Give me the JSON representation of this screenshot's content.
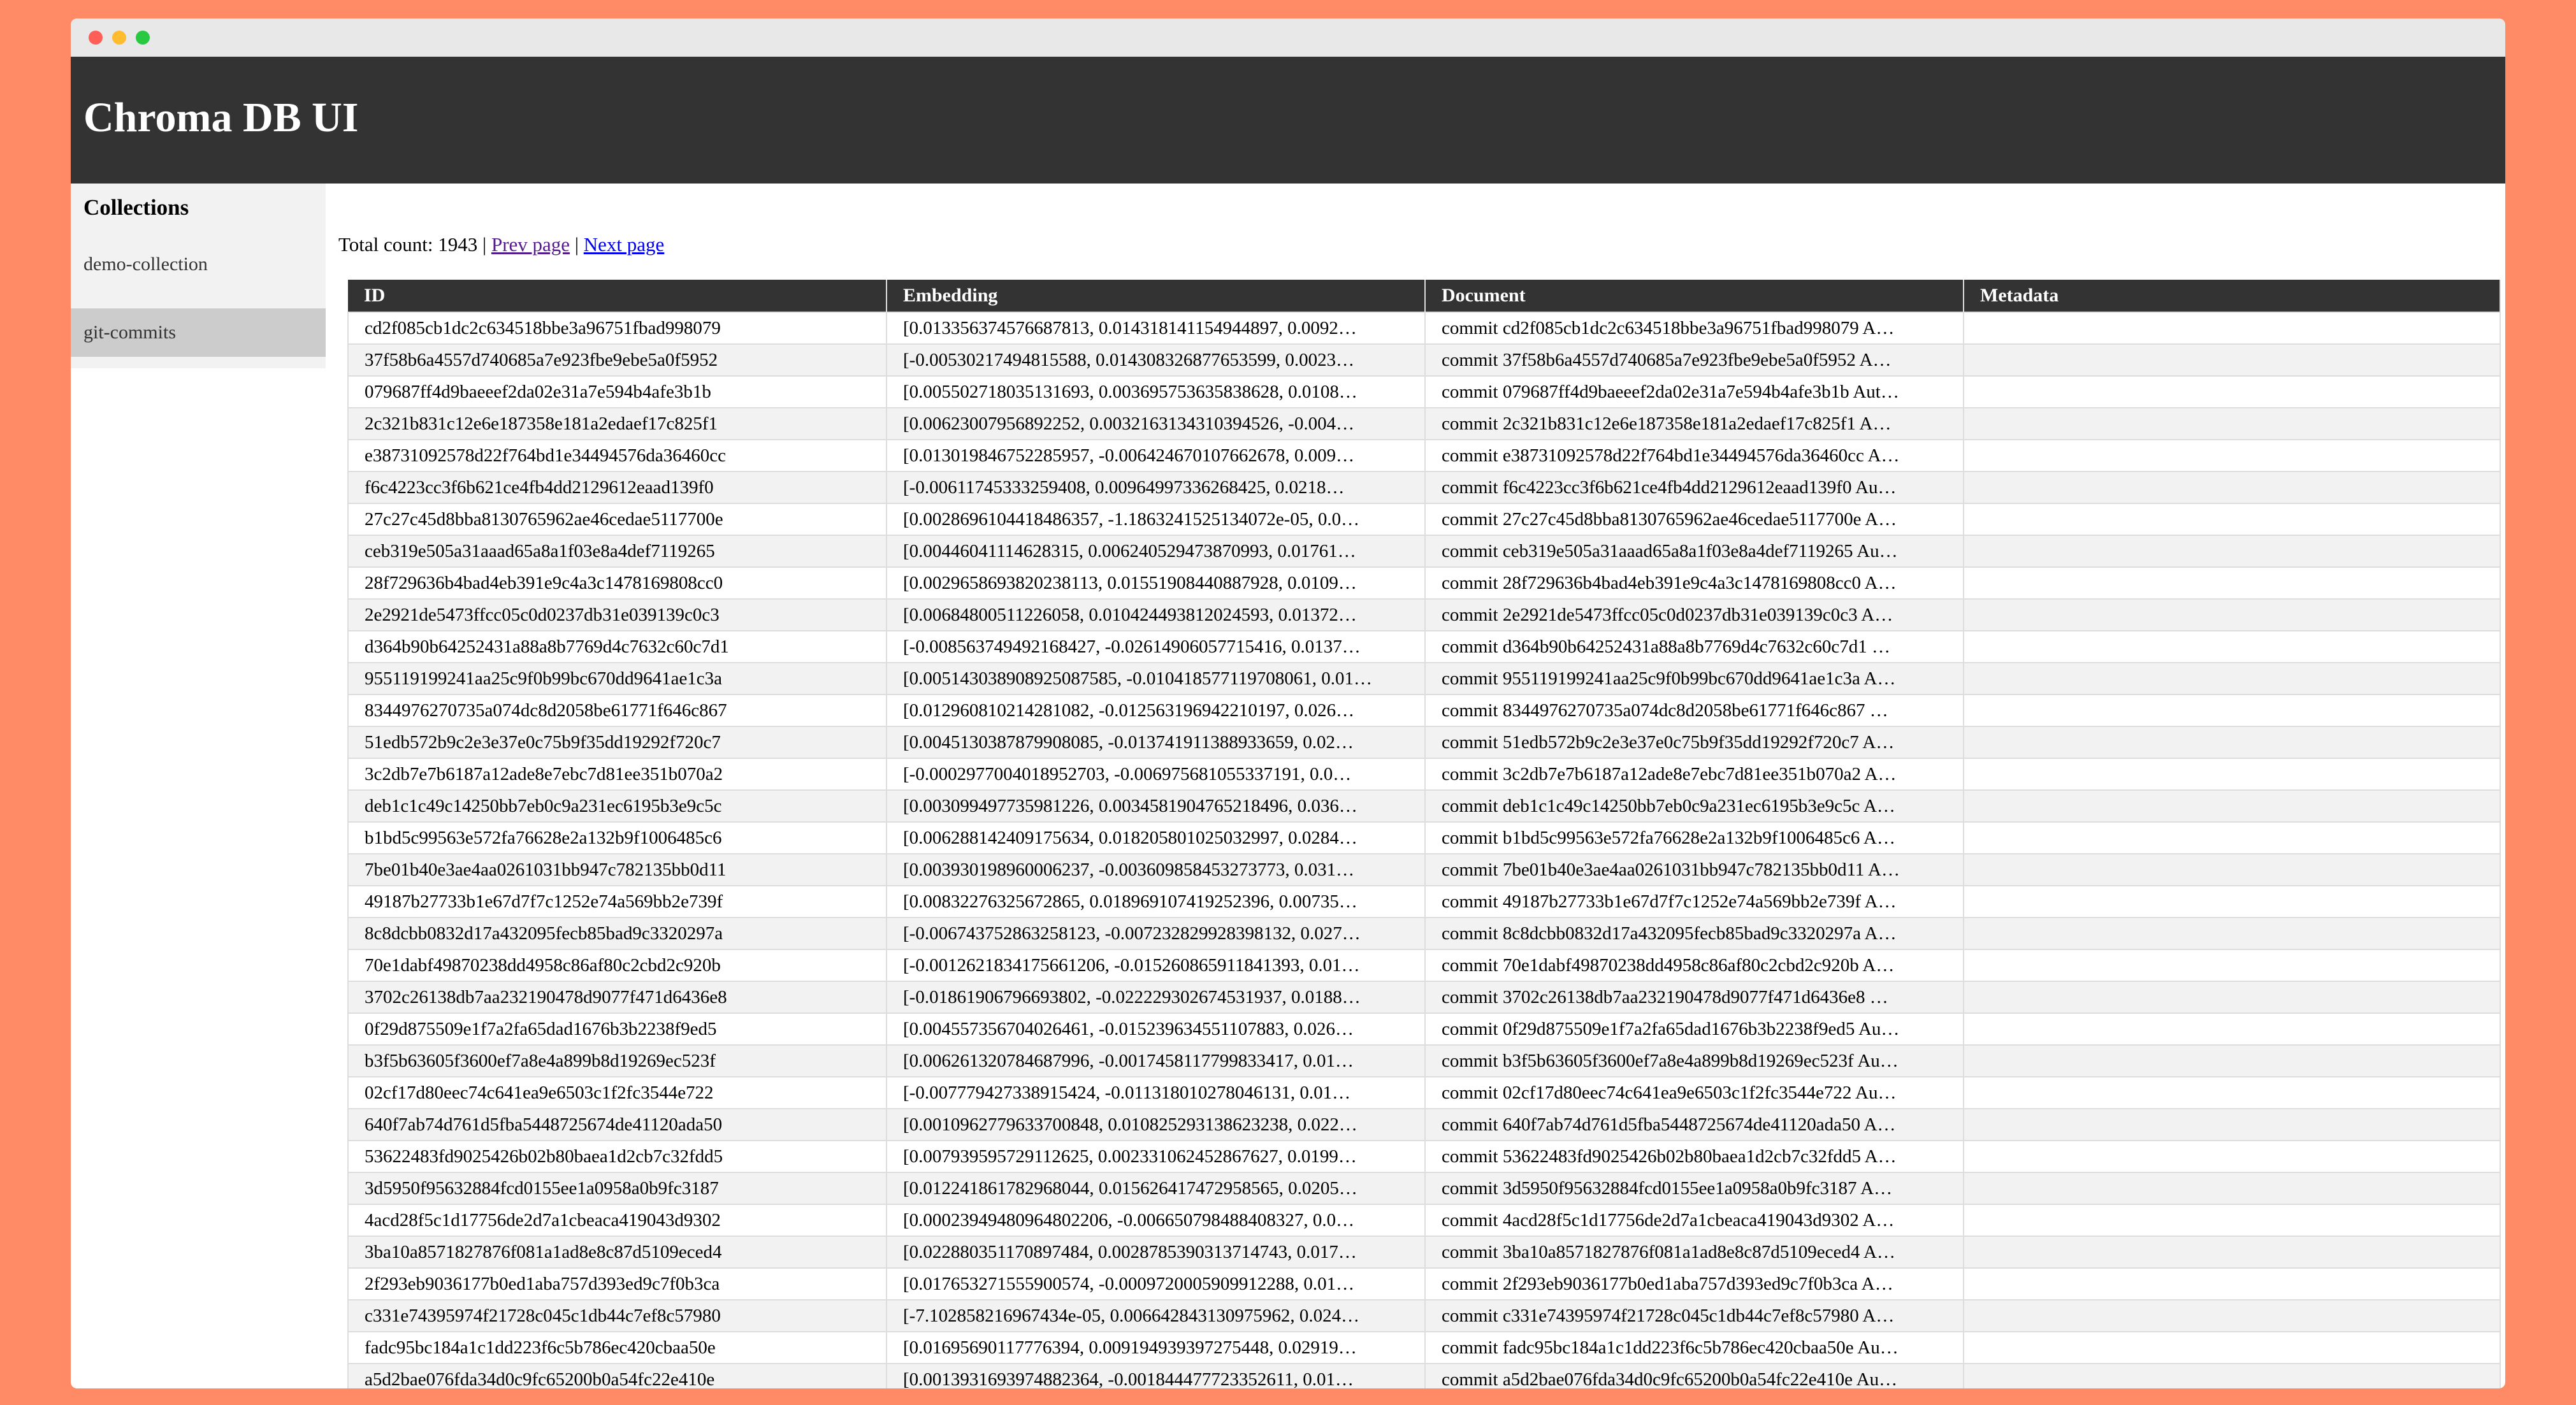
{
  "app": {
    "title": "Chroma DB UI"
  },
  "sidebar": {
    "heading": "Collections",
    "items": [
      {
        "label": "demo-collection"
      },
      {
        "label": "git-commits"
      }
    ]
  },
  "pager": {
    "total_label": "Total count: 1943",
    "separator": "|",
    "prev_label": "Prev page",
    "next_label": "Next page"
  },
  "table": {
    "columns": [
      "ID",
      "Embedding",
      "Document",
      "Metadata"
    ],
    "rows": [
      {
        "id": "cd2f085cb1dc2c634518bbe3a96751fbad998079",
        "embedding": "[0.013356374576687813, 0.014318141154944897, 0.0092…",
        "document": "commit cd2f085cb1dc2c634518bbe3a96751fbad998079 A…",
        "metadata": ""
      },
      {
        "id": "37f58b6a4557d740685a7e923fbe9ebe5a0f5952",
        "embedding": "[-0.00530217494815588, 0.014308326877653599, 0.0023…",
        "document": "commit 37f58b6a4557d740685a7e923fbe9ebe5a0f5952 A…",
        "metadata": ""
      },
      {
        "id": "079687ff4d9baeeef2da02e31a7e594b4afe3b1b",
        "embedding": "[0.005502718035131693, 0.003695753635838628, 0.0108…",
        "document": "commit 079687ff4d9baeeef2da02e31a7e594b4afe3b1b Aut…",
        "metadata": ""
      },
      {
        "id": "2c321b831c12e6e187358e181a2edaef17c825f1",
        "embedding": "[0.00623007956892252, 0.003216313431039452​6, -0.004…",
        "document": "commit 2c321b831c12e6e187358e181a2edaef17c825f1 A…",
        "metadata": ""
      },
      {
        "id": "e38731092578d22f764bd1e34494576da36460cc",
        "embedding": "[0.013019846752285957, -0.006424670107662678, 0.009…",
        "document": "commit e38731092578d22f764bd1e34494576da36460cc A…",
        "metadata": ""
      },
      {
        "id": "f6c4223cc3f6b621ce4fb4dd2129612eaad139f0",
        "embedding": "[-0.00611745333259408, 0.00964997336268425, 0.0218…",
        "document": "commit f6c4223cc3f6b621ce4fb4dd2129612eaad139f0 Au…",
        "metadata": ""
      },
      {
        "id": "27c27c45d8bba8130765962ae46cedae5117700e",
        "embedding": "[0.0028696104418486357, -1.1863241525134072e-05, 0.0…",
        "document": "commit 27c27c45d8bba8130765962ae46cedae5117700e A…",
        "metadata": ""
      },
      {
        "id": "ceb319e505a31aaad65a8a1f03e8a4def7119265",
        "embedding": "[0.00446041114628315, 0.006240529473870993, 0.01761…",
        "document": "commit ceb319e505a31aaad65a8a1f03e8a4def7119265 Au…",
        "metadata": ""
      },
      {
        "id": "28f729636b4bad4eb391e9c4a3c1478169808cc0",
        "embedding": "[0.0029658693820238113, 0.01551908440887928, 0.0109…",
        "document": "commit 28f729636b4bad4eb391e9c4a3c1478169808cc0 A…",
        "metadata": ""
      },
      {
        "id": "2e2921de5473ffcc05c0d0237db31e039139c0c3",
        "embedding": "[0.00684800511226058, 0.010424493812024593, 0.01372…",
        "document": "commit 2e2921de5473ffcc05c0d0237db31e039139c0c3 A…",
        "metadata": ""
      },
      {
        "id": "d364b90b64252431a88a8b7769d4c7632c60c7d1",
        "embedding": "[-0.008563749492168427, -0.02614906057715416, 0.0137…",
        "document": "commit d364b90b64252431a88a8b7769d4c7632c60c7d1 …",
        "metadata": ""
      },
      {
        "id": "955119199241aa25c9f0b99bc670dd9641ae1c3a",
        "embedding": "[0.005143038908925087585, -0.01041857711970806​1, 0.01…",
        "document": "commit 955119199241aa25c9f0b99bc670dd9641ae1c3a A…",
        "metadata": ""
      },
      {
        "id": "8344976270735a074dc8d2058be61771f646c867",
        "embedding": "[0.012960810214281082, -0.012563196942210197, 0.026…",
        "document": "commit 8344976270735a074dc8d2058be61771f646c867 …",
        "metadata": ""
      },
      {
        "id": "51edb572b9c2e3e37e0c75b9f35dd19292f720c7",
        "embedding": "[0.0045130387879908085, -0.013741911388933659, 0.02…",
        "document": "commit 51edb572b9c2e3e37e0c75b9f35dd19292f720c7 A…",
        "metadata": ""
      },
      {
        "id": "3c2db7e7b6187a12ade8e7ebc7d81ee351b070a2",
        "embedding": "[-0.0002977004018952703, -0.006975681055337191, 0.0…",
        "document": "commit 3c2db7e7b6187a12ade8e7ebc7d81ee351b070a2 A…",
        "metadata": ""
      },
      {
        "id": "deb1c1c49c14250bb7eb0c9a231ec6195b3e9c5c",
        "embedding": "[0.003099497735981226, 0.0034581904765218496, 0.036…",
        "document": "commit deb1c1c49c14250bb7eb0c9a231ec6195b3e9c5c A…",
        "metadata": ""
      },
      {
        "id": "b1bd5c99563e572fa76628e2a132b9f1006485c6",
        "embedding": "[0.006288142409175634, 0.018205801025032997, 0.0284…",
        "document": "commit b1bd5c99563e572fa76628e2a132b9f1006485c6 A…",
        "metadata": ""
      },
      {
        "id": "7be01b40e3ae4aa0261031bb947c782135bb0d11",
        "embedding": "[0.003930198960006237, -0.003609858453273773, 0.031…",
        "document": "commit 7be01b40e3ae4aa0261031bb947c782135bb0d11 A…",
        "metadata": ""
      },
      {
        "id": "49187b27733b1e67d7f7c1252e74a569bb2e739f",
        "embedding": "[0.008322763256728​65, 0.018969107419252396, 0.00735…",
        "document": "commit 49187b27733b1e67d7f7c1252e74a569bb2e739f A…",
        "metadata": ""
      },
      {
        "id": "8c8dcbb0832d17a432095fecb85bad9c3320297a",
        "embedding": "[-0.006743752863258123, -0.007232829928398132, 0.027…",
        "document": "commit 8c8dcbb0832d17a432095fecb85bad9c3320297a A…",
        "metadata": ""
      },
      {
        "id": "70e1dabf49870238dd4958c86af80c2cbd2c920b",
        "embedding": "[-0.001262183417566​1206, -0.015260865911841393, 0.01…",
        "document": "commit 70e1dabf49870238dd4958c86af80c2cbd2c920b A…",
        "metadata": ""
      },
      {
        "id": "3702c26138db7aa232190478d9077f471d6436e8",
        "embedding": "[-0.01861906796693802, -0.022229302674531937, 0.0188…",
        "document": "commit 3702c26138db7aa232190478d9077f471d6436e8 …",
        "metadata": ""
      },
      {
        "id": "0f29d875509e1f7a2fa65dad1676b3b2238f9ed5",
        "embedding": "[0.004557356704026461, -0.015239634551107883, 0.026…",
        "document": "commit 0f29d875509e1f7a2fa65dad1676b3b2238f9ed5 Au…",
        "metadata": ""
      },
      {
        "id": "b3f5b63605f3600ef7a8e4a899b8d19269ec523f",
        "embedding": "[0.006261320784687996, -0.0017458117799833417, 0.01…",
        "document": "commit b3f5b63605f3600ef7a8e4a899b8d19269ec523f Au…",
        "metadata": ""
      },
      {
        "id": "02cf17d80eec74c641ea9e6503c1f2fc3544e722",
        "embedding": "[-0.007779427338915424, -0.011318010278046131, 0.01…",
        "document": "commit 02cf17d80eec74c641ea9e6503c1f2fc3544e722 Au…",
        "metadata": ""
      },
      {
        "id": "640f7ab74d761d5fba5448725674de41120ada50",
        "embedding": "[0.0010962779633700848, 0.010825293138623238, 0.022…",
        "document": "commit 640f7ab74d761d5fba5448725674de41120ada50 A…",
        "metadata": ""
      },
      {
        "id": "53622483fd9025426b02b80baea1d2cb7c32fdd5",
        "embedding": "[0.007939595729112625, 0.002331062452867627, 0.0199…",
        "document": "commit 53622483fd9025426b02b80baea1d2cb7c32fdd5 A…",
        "metadata": ""
      },
      {
        "id": "3d5950f95632884fcd0155ee1a0958a0b9fc3187",
        "embedding": "[0.012241861782968044, 0.015626417472958565, 0.0205…",
        "document": "commit 3d5950f95632884fcd0155ee1a0958a0b9fc3187 A…",
        "metadata": ""
      },
      {
        "id": "4acd28f5c1d17756de2d7a1cbeaca419043d9302",
        "embedding": "[0.00023949480964802206, -0.006650798488408327, 0.0…",
        "document": "commit 4acd28f5c1d17756de2d7a1cbeaca419043d9302 A…",
        "metadata": ""
      },
      {
        "id": "3ba10a8571827876f081a1ad8e8c87d5109eced4",
        "embedding": "[0.022880351170897484, 0.002878539031371474​3, 0.017…",
        "document": "commit 3ba10a8571827876f081a1ad8e8c87d5109eced4 A…",
        "metadata": ""
      },
      {
        "id": "2f293eb9036177b0ed1aba757d393ed9c7f0b3ca",
        "embedding": "[0.017653271555900574, -0.0009720005909912288, 0.01…",
        "document": "commit 2f293eb9036177b0ed1aba757d393ed9c7f0b3ca A…",
        "metadata": ""
      },
      {
        "id": "c331e74395974f21728c045c1db44c7ef8c57980",
        "embedding": "[-7.102858216967434e-05, 0.006642843130975962, 0.024…",
        "document": "commit c331e74395974f21728c045c1db44c7ef8c57980 A…",
        "metadata": ""
      },
      {
        "id": "fadc95bc184a1c1dd223f6c5b786ec420cbaa50e",
        "embedding": "[0.01695690117776394, 0.009194939397275448, 0.02919…",
        "document": "commit fadc95bc184a1c1dd223f6c5b786ec420cbaa50e Au…",
        "metadata": ""
      },
      {
        "id": "a5d2bae076fda34d0c9fc65200b0a54fc22e410e",
        "embedding": "[0.0013931693974882364, -0.001844477723352611, 0.01…",
        "document": "commit a5d2bae076fda34d0c9fc65200b0a54fc22e410e Au…",
        "metadata": ""
      }
    ]
  }
}
